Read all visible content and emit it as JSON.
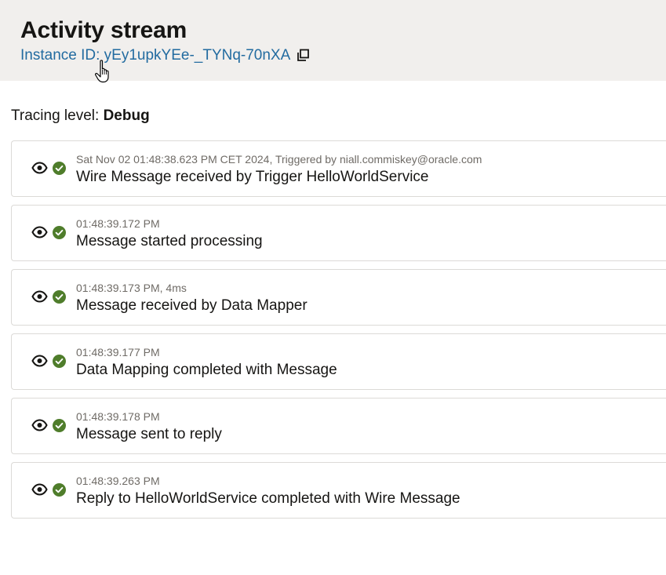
{
  "header": {
    "title": "Activity stream",
    "instance_id": "Instance ID: yEy1upkYEe-_TYNq-70nXA"
  },
  "tracing": {
    "label": "Tracing level:",
    "value": "Debug"
  },
  "colors": {
    "success": "#4f7d2b",
    "link": "#226ba0",
    "header_bg": "#f1efed"
  },
  "activities": [
    {
      "meta": "Sat Nov 02 01:48:38.623 PM CET 2024, Triggered by niall.commiskey@oracle.com",
      "message": "Wire Message received by Trigger HelloWorldService",
      "icon": "eye-icon",
      "status": "check-circle-icon"
    },
    {
      "meta": "01:48:39.172 PM",
      "message": "Message started processing",
      "icon": "eye-icon",
      "status": "check-circle-icon"
    },
    {
      "meta": "01:48:39.173 PM, 4ms",
      "message": "Message received by Data Mapper",
      "icon": "eye-icon",
      "status": "check-circle-icon"
    },
    {
      "meta": "01:48:39.177 PM",
      "message": "Data Mapping completed with Message",
      "icon": "eye-icon",
      "status": "check-circle-icon"
    },
    {
      "meta": "01:48:39.178 PM",
      "message": "Message sent to reply",
      "icon": "eye-icon",
      "status": "check-circle-icon"
    },
    {
      "meta": "01:48:39.263 PM",
      "message": "Reply to HelloWorldService completed with Wire Message",
      "icon": "eye-icon",
      "status": "check-circle-icon"
    }
  ]
}
